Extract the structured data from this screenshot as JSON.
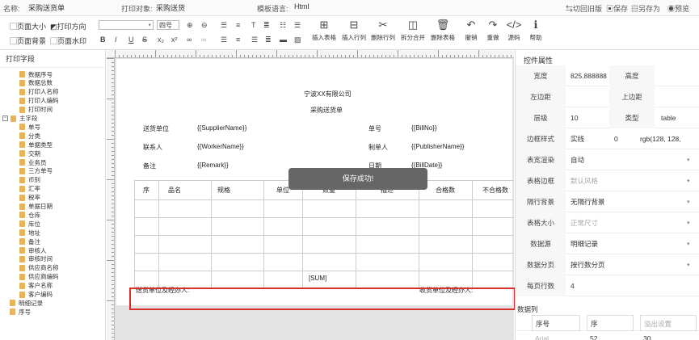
{
  "topbar": {
    "name_label": "名称:",
    "name_value": "采购送货单",
    "print_obj_label": "打印对象:",
    "print_obj_value": "采购送货",
    "tpl_lang_label": "模板语言:",
    "tpl_lang_value": "Html",
    "switch_old": "切回旧版",
    "save": "保存",
    "save_as": "另存为",
    "preview": "预览"
  },
  "toolbar": {
    "page_size": "页面大小",
    "print_direction": "打印方向",
    "page_bg": "页面背景",
    "page_watermark": "页面水印",
    "font_size": "四号",
    "big_buttons": [
      "插入表格",
      "插入行列",
      "删除行列",
      "拆分合并",
      "删除表格",
      "撤销",
      "重做",
      "源码",
      "帮助"
    ]
  },
  "left": {
    "title": "打印字段",
    "items": [
      {
        "label": "数据序号",
        "type": "file"
      },
      {
        "label": "数据总数",
        "type": "file"
      },
      {
        "label": "打印人名称",
        "type": "file"
      },
      {
        "label": "打印人编码",
        "type": "file"
      },
      {
        "label": "打印时间",
        "type": "file"
      },
      {
        "label": "主字段",
        "type": "folder"
      },
      {
        "label": "单号",
        "type": "file"
      },
      {
        "label": "分类",
        "type": "file"
      },
      {
        "label": "单据类型",
        "type": "file"
      },
      {
        "label": "交期",
        "type": "file"
      },
      {
        "label": "业务员",
        "type": "file"
      },
      {
        "label": "三方单号",
        "type": "file"
      },
      {
        "label": "币别",
        "type": "file"
      },
      {
        "label": "汇率",
        "type": "file"
      },
      {
        "label": "税率",
        "type": "file"
      },
      {
        "label": "单据日期",
        "type": "file"
      },
      {
        "label": "仓库",
        "type": "file"
      },
      {
        "label": "库位",
        "type": "file"
      },
      {
        "label": "地址",
        "type": "file"
      },
      {
        "label": "备注",
        "type": "file"
      },
      {
        "label": "审核人",
        "type": "file"
      },
      {
        "label": "审核时间",
        "type": "file"
      },
      {
        "label": "供应商名称",
        "type": "file"
      },
      {
        "label": "供应商编码",
        "type": "file"
      },
      {
        "label": "客户名称",
        "type": "file"
      },
      {
        "label": "客户编码",
        "type": "file"
      },
      {
        "label": "明细记录",
        "type": "folder2"
      },
      {
        "label": "序号",
        "type": "folder2"
      }
    ]
  },
  "paper": {
    "company": "宁波XX有限公司",
    "doc_title": "采购送货单",
    "f1_label": "送货单位",
    "f1_value": "{{SupplierName}}",
    "f2_label": "单号",
    "f2_value": "{{BillNo}}",
    "f3_label": "联系人",
    "f3_value": "{{WorkerName}}",
    "f4_label": "制单人",
    "f4_value": "{{PublisherName}}",
    "f5_label": "备注",
    "f5_value": "{{Remark}}",
    "f6_label": "日期",
    "f6_value": "{{BillDate}}",
    "columns": [
      "序",
      "品名",
      "规格",
      "单位",
      "数量",
      "描述",
      "合格数",
      "不合格数"
    ],
    "sum": "[SUM]",
    "sign_left": "送货单位及经办人:",
    "sign_right": "收货单位及经办人:",
    "toast": "保存成功!"
  },
  "right": {
    "title": "控件属性",
    "width_label": "宽度",
    "width_value": "825.888888",
    "height_label": "高度",
    "left_margin_label": "左边距",
    "top_margin_label": "上边距",
    "level_label": "层级",
    "level_value": "10",
    "type_label": "类型",
    "type_value": "table",
    "border_style_label": "边框样式",
    "border_style_value": "实线",
    "border_width_value": "0",
    "border_color_value": "rgb(128, 128,",
    "render_label": "表宽渲染",
    "render_value": "自动",
    "table_border_label": "表格边框",
    "table_border_value": "默认风格",
    "row_bg_label": "隔行背景",
    "row_bg_value": "无隔行背景",
    "table_size_label": "表格大小",
    "table_size_value": "正常尺寸",
    "datasource_label": "数据源",
    "datasource_value": "明细记录",
    "paging_label": "数据分页",
    "paging_value": "按行数分页",
    "rows_per_page_label": "每页行数",
    "rows_per_page_value": "4",
    "data_columns_title": "数据列",
    "col_row1_a": "序号",
    "col_row1_b": "序",
    "col_row1_c": "溢出设置",
    "col_row2_a": "Arial",
    "col_row2_b": "52",
    "col_row2_c": "30"
  }
}
